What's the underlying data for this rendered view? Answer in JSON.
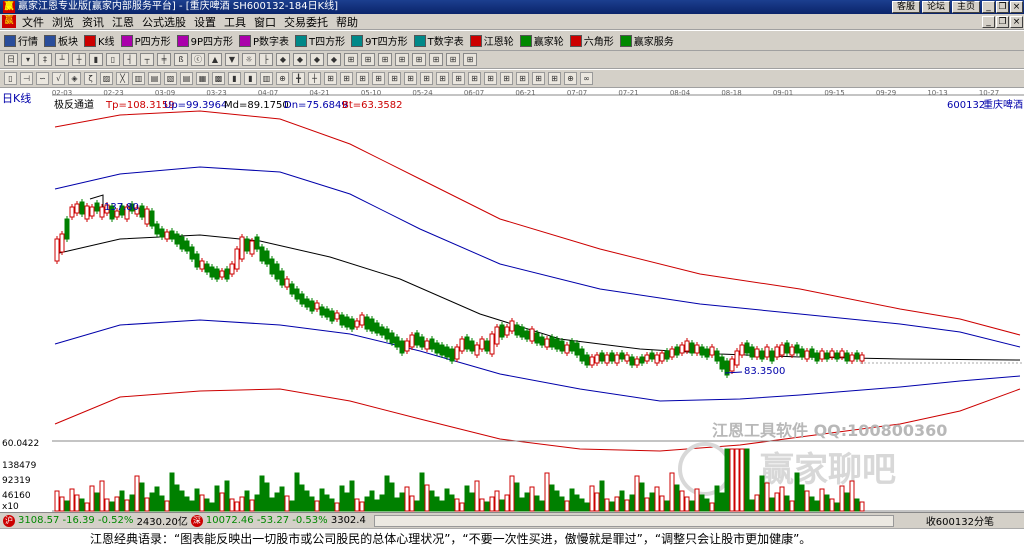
{
  "window": {
    "title": "赢家江恩专业版[赢家内部服务平台] - [重庆啤酒  SH600132-184日K线]",
    "app_icon": "赢",
    "buttons": [
      "客服",
      "论坛",
      "主页"
    ]
  },
  "menu": {
    "logo": "赢",
    "items": [
      "文件",
      "浏览",
      "资讯",
      "江恩",
      "公式选股",
      "设置",
      "工具",
      "窗口",
      "交易委托",
      "帮助"
    ]
  },
  "toolbar1": {
    "items": [
      {
        "label": "行情",
        "color": "#2a4d9a"
      },
      {
        "label": "板块",
        "color": "#2a4d9a"
      },
      {
        "label": "K线",
        "color": "#c00"
      },
      {
        "label": "P四方形",
        "color": "#a0a"
      },
      {
        "label": "9P四方形",
        "color": "#a0a"
      },
      {
        "label": "P数字表",
        "color": "#a0a"
      },
      {
        "label": "T四方形",
        "color": "#088"
      },
      {
        "label": "9T四方形",
        "color": "#088"
      },
      {
        "label": "T数字表",
        "color": "#088"
      },
      {
        "label": "江恩轮",
        "color": "#c00"
      },
      {
        "label": "赢家轮",
        "color": "#080"
      },
      {
        "label": "六角形",
        "color": "#c00"
      },
      {
        "label": "赢家服务",
        "color": "#080"
      }
    ]
  },
  "toolbar2": {
    "items": [
      "日",
      "▾",
      "‡",
      "┴",
      "┼",
      "▮",
      "▯",
      "┤",
      "┬",
      "╪",
      "ß",
      "ⓒ",
      "▲",
      "▼",
      "☼",
      "├",
      "◆",
      "◆",
      "◆",
      "◆",
      "⊞",
      "⊞",
      "⊞",
      "⊞",
      "⊞",
      "⊞",
      "⊞",
      "⊞"
    ]
  },
  "toolbar3": {
    "items": [
      "▯",
      "⊣",
      "∽",
      "√",
      "◈",
      "ζ",
      "▨",
      "╳",
      "▥",
      "▤",
      "▧",
      "▤",
      "▦",
      "▩",
      "▮",
      "▮",
      "▥",
      "⊕",
      "╋",
      "┼",
      "⊞",
      "⊞",
      "⊞",
      "⊞",
      "⊞",
      "⊞",
      "⊞",
      "⊞",
      "⊞",
      "⊞",
      "⊞",
      "⊞",
      "⊞",
      "⊞",
      "⊞",
      "⊕",
      "∞"
    ]
  },
  "chart": {
    "period_label": "日K线",
    "indicator": "极反通道",
    "values": [
      {
        "text": "Tp=108.3159",
        "color": "#c00"
      },
      {
        "text": "Up=99.3964",
        "color": "#00a"
      },
      {
        "text": "Md=89.1750",
        "color": "#000"
      },
      {
        "text": "Dn=75.6849",
        "color": "#00a"
      },
      {
        "text": "Bt=63.3582",
        "color": "#c00"
      }
    ],
    "stock_code": "600132",
    "stock_name": "重庆啤酒",
    "dates": [
      "02-03",
      "02-23",
      "03-09",
      "03-23",
      "04-07",
      "04-21",
      "05-10",
      "05-24",
      "06-07",
      "06-21",
      "07-07",
      "07-21",
      "08-04",
      "08-18",
      "09-01",
      "09-15",
      "09-29",
      "10-13",
      "10-27"
    ],
    "high_label": "137.80",
    "low_label": "83.3500",
    "watermark": "江恩工具软件  QQ:100800360",
    "watermark2": "赢家聊吧",
    "vol_labels": [
      "60.0422",
      "138479",
      "92319",
      "46160"
    ],
    "vol_unit": "x10"
  },
  "status": {
    "sh": "3108.57",
    "sh_chg": "-16.39",
    "sh_pct": "-0.52%",
    "sh_amt": "2430.20亿",
    "sz": "10072.46",
    "sz_chg": "-53.27",
    "sz_pct": "-0.53%",
    "sz_amt": "3302.4",
    "right": "收600132分笔"
  },
  "quote": "江恩经典语录：“图表能反映出一切股市或公司股民的总体心理状况”，“不要一次性买进，傲慢就是罪过”，“调整只会让股市更加健康”。"
}
